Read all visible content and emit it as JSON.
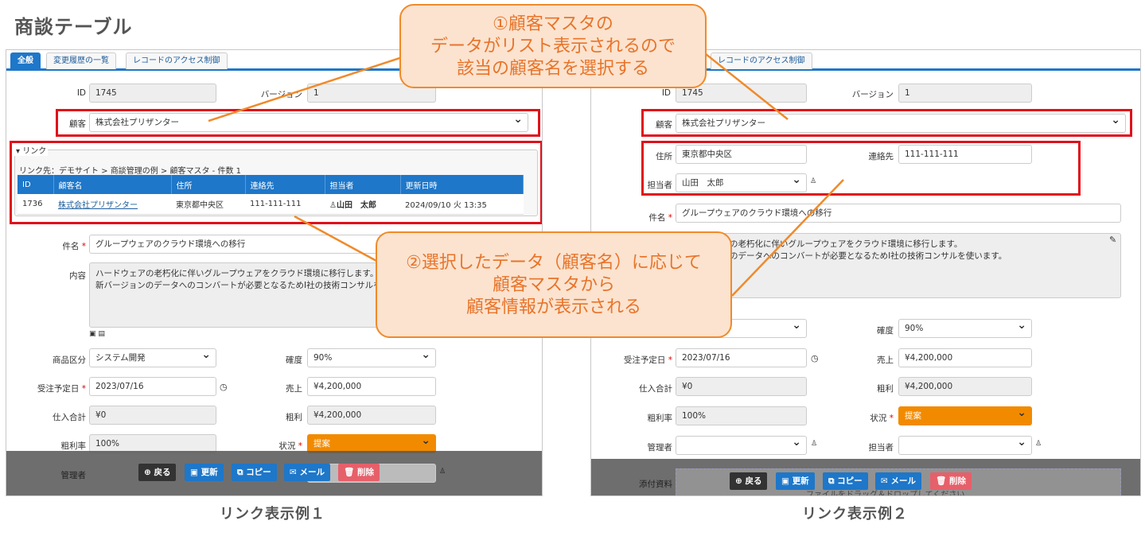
{
  "page_title": "商談テーブル",
  "colors": {
    "accent": "#1e77c9",
    "highlight": "#e0101a",
    "callout_border": "#f08a2a",
    "callout_text": "#e8742a",
    "status_orange": "#f28a00"
  },
  "left": {
    "tabs": [
      "全般",
      "変更履歴の一覧",
      "レコードのアクセス制御"
    ],
    "id_label": "ID",
    "id_value": "1745",
    "version_label": "バージョン",
    "version_value": "1",
    "customer_label": "顧客",
    "customer_value": "株式会社プリザンター",
    "link_legend": "▾ リンク",
    "link_path": "リンク先：デモサイト > 商談管理の例 > 顧客マスタ - 件数 1",
    "link_table": {
      "headers": [
        "ID",
        "顧客名",
        "住所",
        "連絡先",
        "担当者",
        "更新日時"
      ],
      "row": [
        "1736",
        "株式会社プリザンター",
        "東京都中央区",
        "111-111-111",
        "山田　太郎",
        "2024/09/10 火 13:35"
      ]
    },
    "subject_label": "件名",
    "subject_value": "グループウェアのクラウド環境への移行",
    "content_label": "内容",
    "content_lines": [
      "ハードウェアの老朽化に伴いグループウェアをクラウド環境に移行します。",
      "新バージョンのデータへのコンバートが必要となるためI社の技術コンサルを"
    ],
    "category_label": "商品区分",
    "category_value": "システム開発",
    "certainty_label": "確度",
    "certainty_value": "90%",
    "order_date_label": "受注予定日",
    "order_date_value": "2023/07/16",
    "sales_label": "売上",
    "sales_value": "¥4,200,000",
    "purchase_label": "仕入合計",
    "purchase_value": "¥0",
    "profit_label": "粗利",
    "profit_value": "¥4,200,000",
    "margin_label": "粗利率",
    "margin_value": "100%",
    "status_label": "状況",
    "status_value": "提案",
    "manager_label": "管理者"
  },
  "right": {
    "tab_visible": "レコードのアクセス制御",
    "id_label": "ID",
    "id_value": "1745",
    "version_label": "バージョン",
    "version_value": "1",
    "customer_label": "顧客",
    "customer_value": "株式会社プリザンター",
    "address_label": "住所",
    "address_value": "東京都中央区",
    "contact_label": "連絡先",
    "contact_value": "111-111-111",
    "person_label": "担当者",
    "person_value": "山田　太郎",
    "subject_label": "件名",
    "subject_value": "グループウェアのクラウド環境への移行",
    "content_lines": [
      "の老朽化に伴いグループウェアをクラウド環境に移行します。",
      "のデータへのコンバートが必要となるためI社の技術コンサルを使います。"
    ],
    "certainty_label": "確度",
    "certainty_value": "90%",
    "order_date_label": "受注予定日",
    "order_date_value": "2023/07/16",
    "sales_label": "売上",
    "sales_value": "¥4,200,000",
    "purchase_label": "仕入合計",
    "purchase_value": "¥0",
    "profit_label": "粗利",
    "profit_value": "¥4,200,000",
    "margin_label": "粗利率",
    "margin_value": "100%",
    "status_label": "状況",
    "status_value": "提案",
    "manager_label": "管理者",
    "person2_label": "担当者",
    "attach_label": "添付資料",
    "drop_hint": "ファイルをドラッグ＆ドロップしてください"
  },
  "buttons": {
    "back": "戻る",
    "update": "更新",
    "copy": "コピー",
    "mail": "メール",
    "delete": "削除"
  },
  "callouts": {
    "one": [
      "①顧客マスタの",
      "データがリスト表示されるので",
      "該当の顧客名を選択する"
    ],
    "two": [
      "②選択したデータ（顧客名）に応じて",
      "顧客マスタから",
      "顧客情報が表示される"
    ]
  },
  "captions": {
    "left": "リンク表示例１",
    "right": "リンク表示例２"
  }
}
